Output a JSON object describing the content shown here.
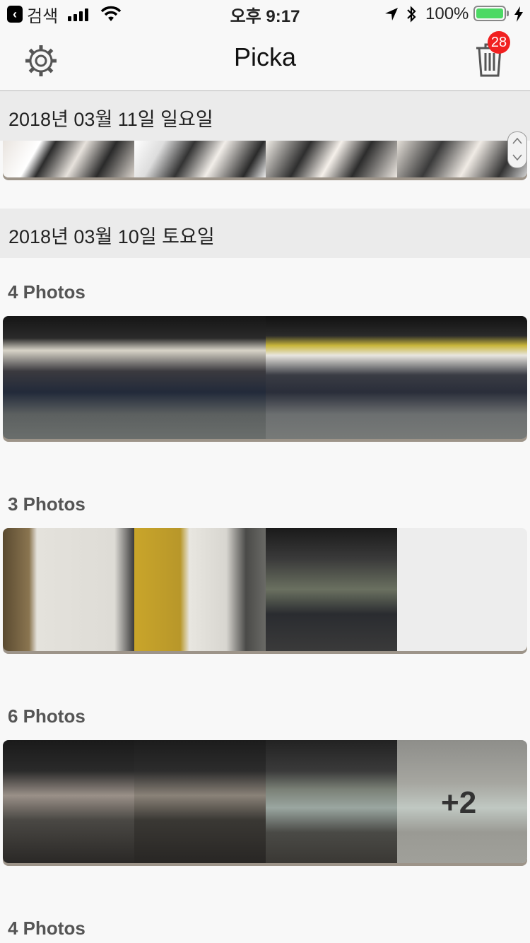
{
  "status_bar": {
    "back_app": "검색",
    "time": "오후 9:17",
    "battery": "100%",
    "battery_level": 1.0
  },
  "nav": {
    "title": "Picka",
    "trash_count": "28",
    "left_icon": "gear-icon",
    "right_icon": "trash-icon"
  },
  "sections": [
    {
      "date": "2018년 03월 11일 일요일",
      "groups": []
    },
    {
      "date": "2018년 03월 10일 토요일",
      "groups": [
        {
          "label": "4 Photos",
          "count": 4
        },
        {
          "label": "3 Photos",
          "count": 3
        },
        {
          "label": "6 Photos",
          "count": 6,
          "more": "+2"
        },
        {
          "label": "4 Photos",
          "count": 4
        }
      ]
    }
  ],
  "colors": {
    "badge": "#f12020",
    "battery": "#4cd964",
    "header_bg": "#ebebeb"
  }
}
